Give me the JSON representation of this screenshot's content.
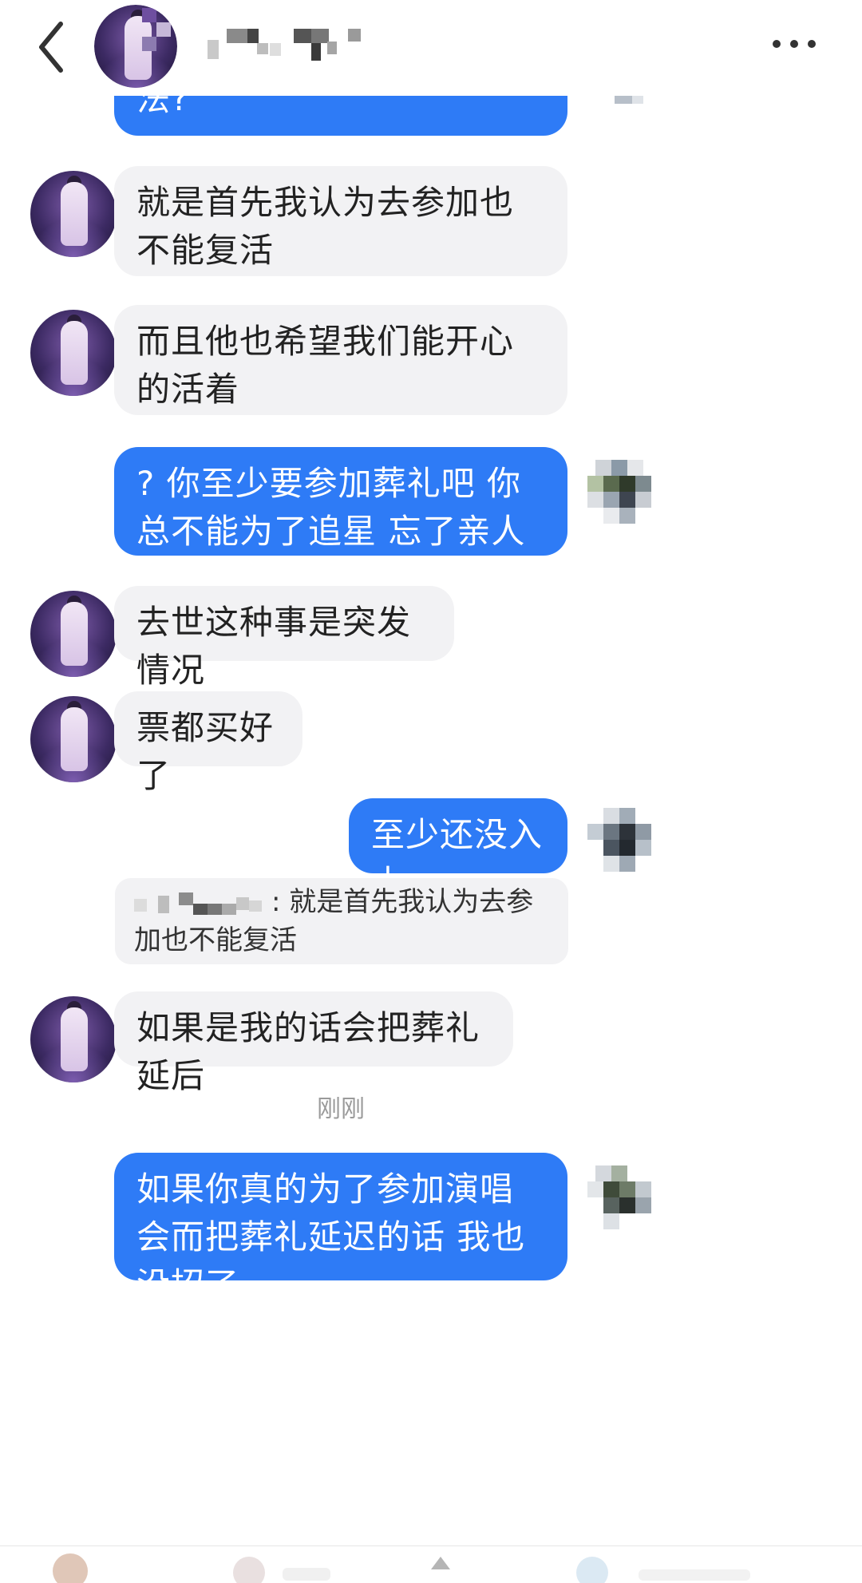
{
  "colors": {
    "outgoing_bubble": "#2e7bf6",
    "incoming_bubble": "#f2f2f4",
    "incoming_text": "#222222",
    "outgoing_text": "#ffffff",
    "timestamp_text": "#9a9a9a"
  },
  "header": {
    "back_icon": "chevron-left-icon",
    "more_icon": "more-horizontal-icon"
  },
  "messages": {
    "m1": "法?",
    "m2": "就是首先我认为去参加也不能复活",
    "m3": "而且他也希望我们能开心的活着",
    "m4": "? 你至少要参加葬礼吧 你总不能为了追星 忘了亲人吧",
    "m5": "去世这种事是突发情况",
    "m6": "票都买好了",
    "m7": "至少还没入土",
    "quote_prefix": ":",
    "quote_text": "就是首先我认为去参加也不能复活",
    "m8": "如果是我的话会把葬礼延后",
    "m9": "如果你真的为了参加演唱会而把葬礼延迟的话 我也没招了"
  },
  "timestamp": "刚刚"
}
